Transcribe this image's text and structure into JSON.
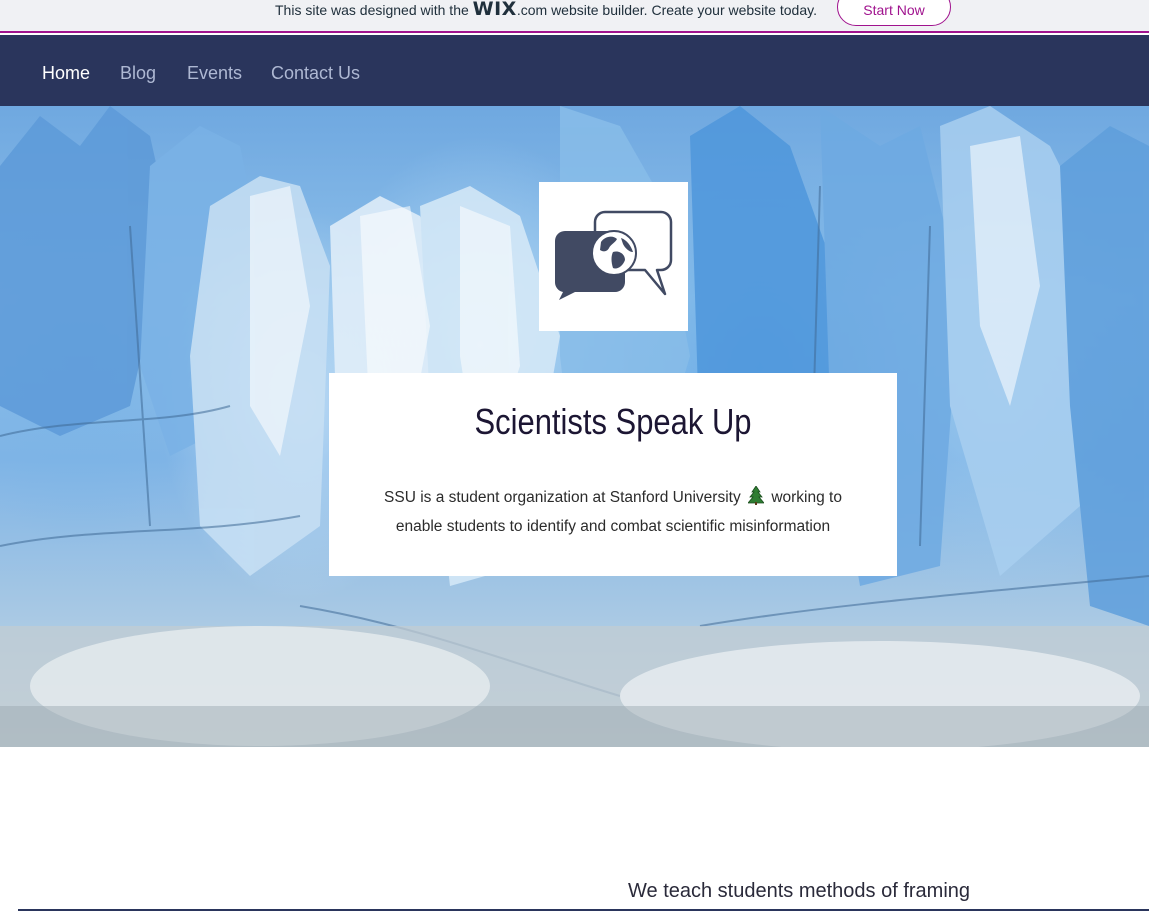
{
  "wix_banner": {
    "text_before": "This site was designed with the",
    "logo": "WIX",
    "text_after": ".com website builder. Create your website today.",
    "button_label": "Start Now",
    "accent_color": "#a0138e"
  },
  "nav": {
    "background": "#2a355c",
    "items": [
      {
        "label": "Home",
        "active": true
      },
      {
        "label": "Blog",
        "active": false
      },
      {
        "label": "Events",
        "active": false
      },
      {
        "label": "Contact Us",
        "active": false
      }
    ]
  },
  "hero": {
    "background_image": "glacier-ice-wall",
    "logo_icon": "speech-bubbles-globe-icon",
    "title": "Scientists Speak Up",
    "desc_before": "SSU is a student organization at Stanford University",
    "desc_icon": "tree-icon",
    "desc_after": "working to enable students to identify and combat scientific misinformation"
  },
  "section": {
    "teach_text": "We teach students methods of framing"
  }
}
